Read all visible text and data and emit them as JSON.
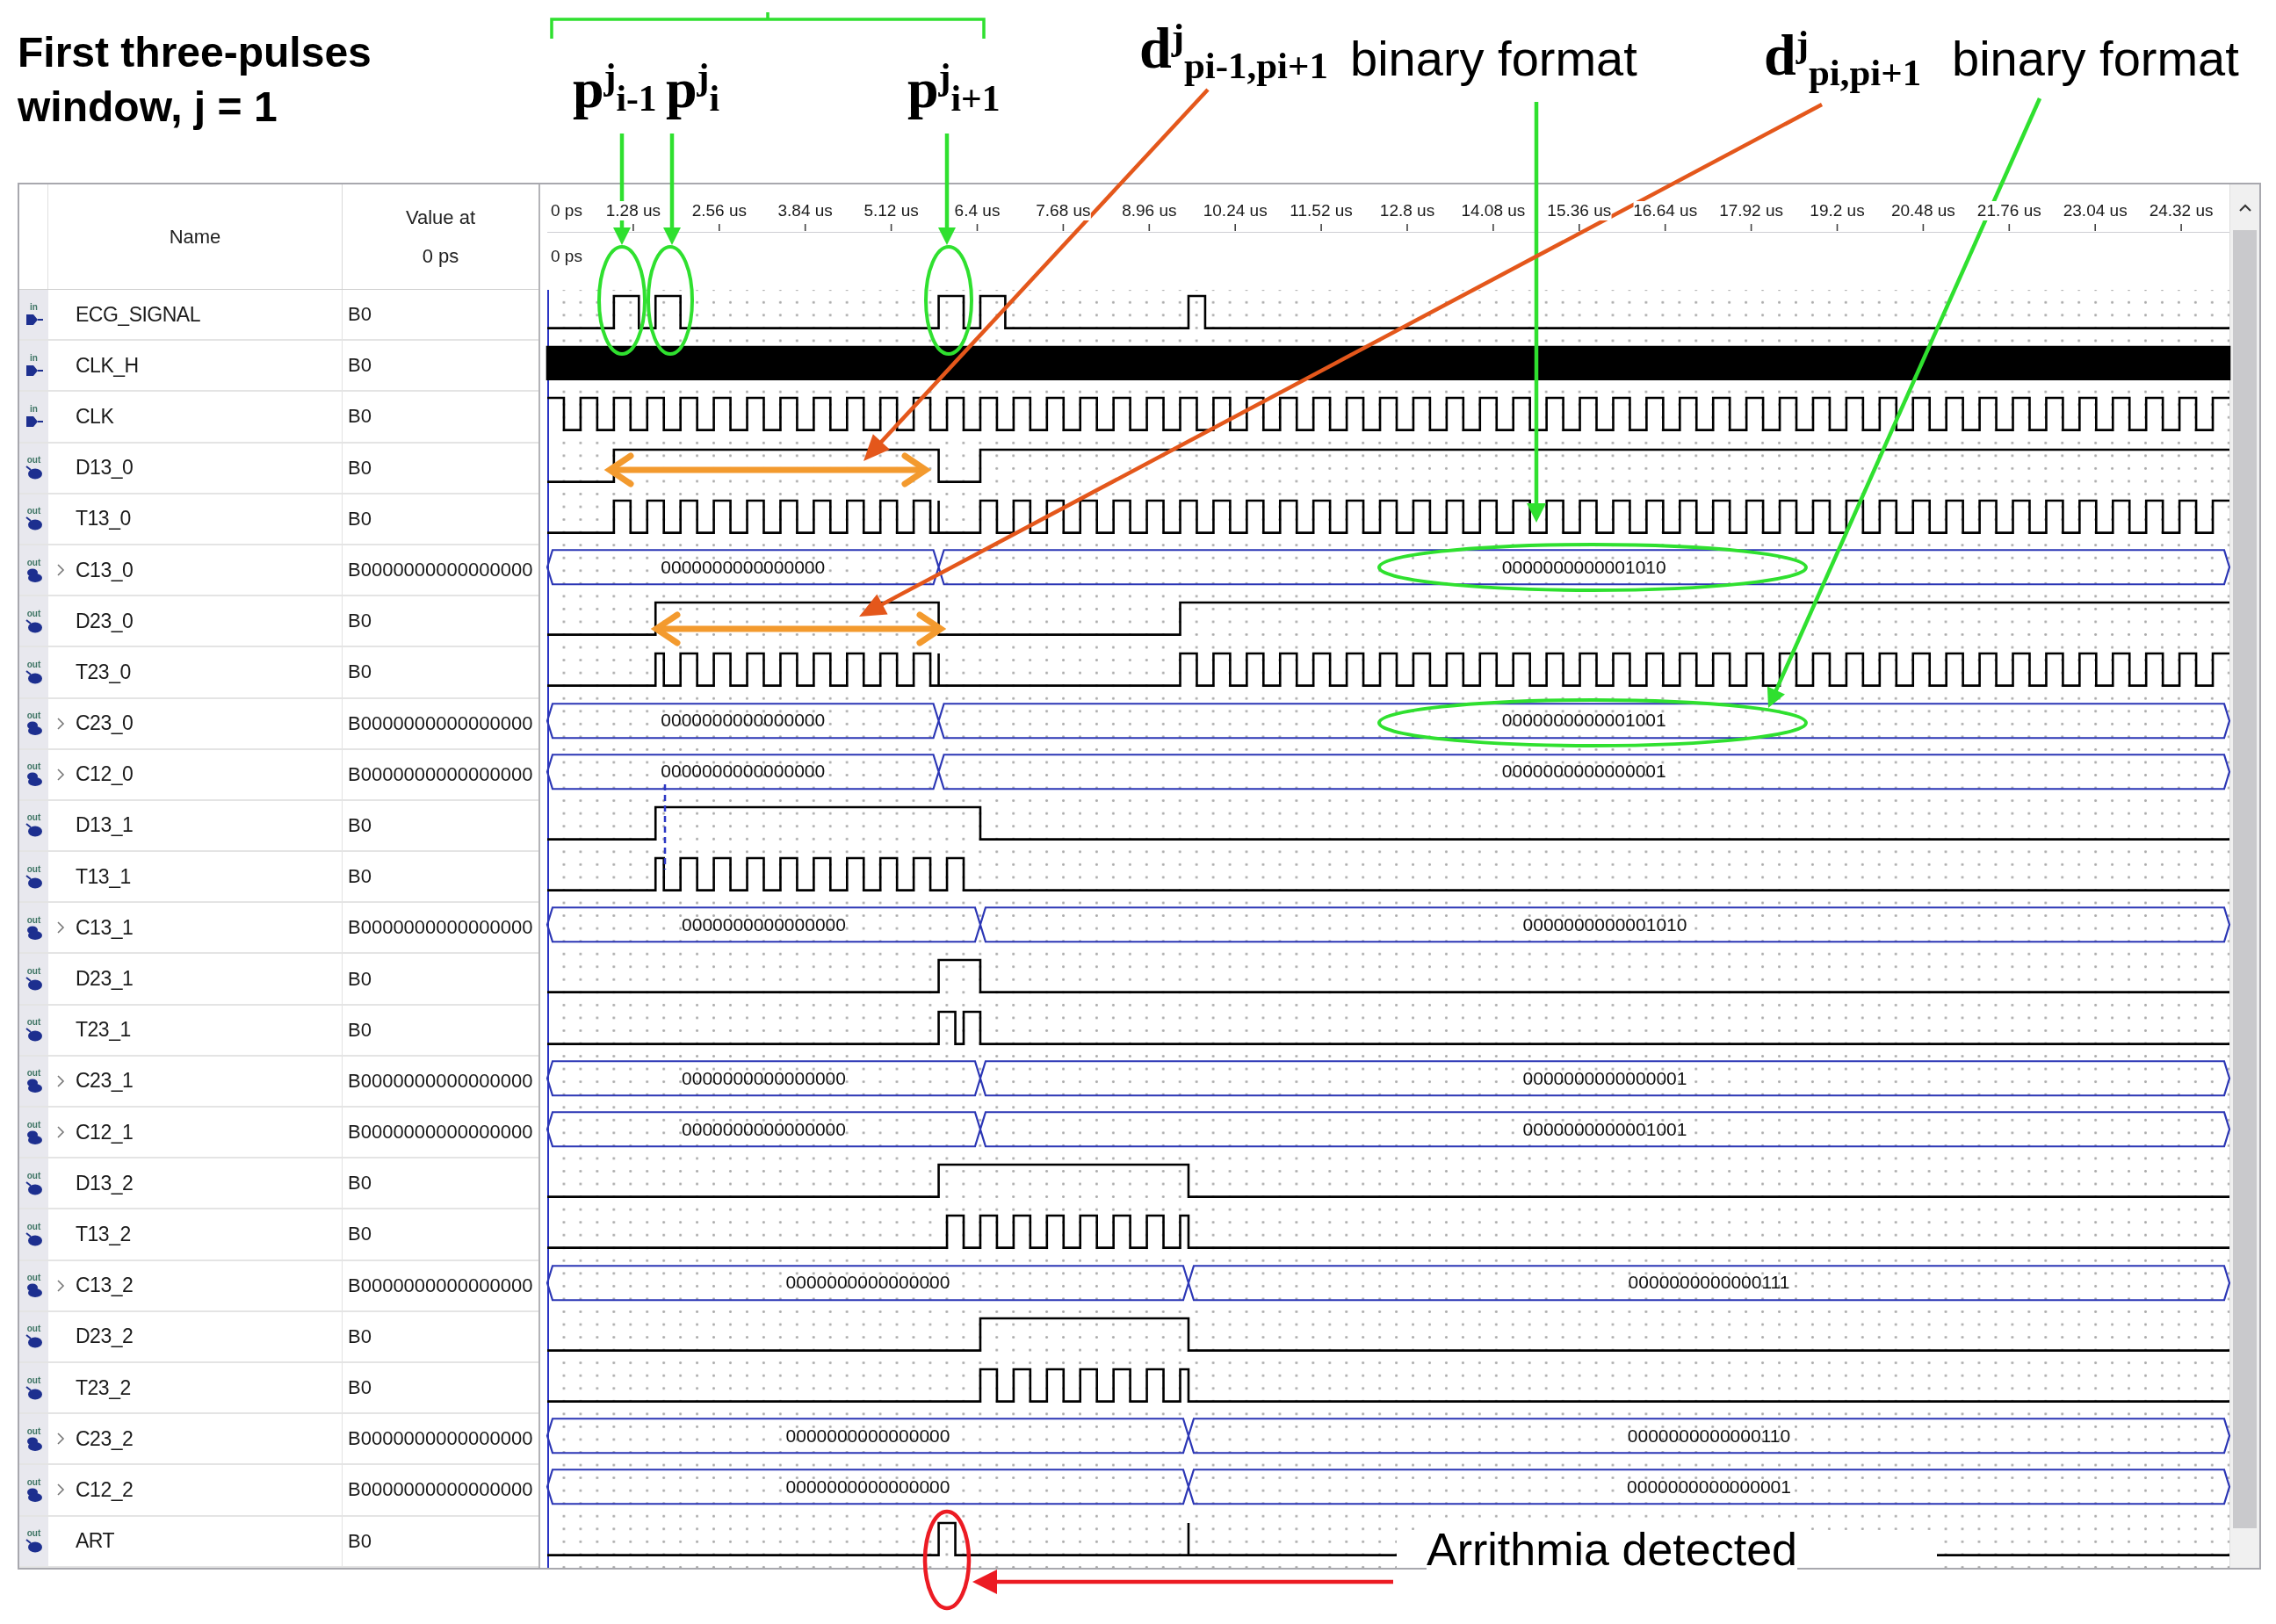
{
  "figure": {
    "title": "First three-pulses window, j = 1"
  },
  "annotations": [
    {
      "kind": "pulse",
      "text": "p$^{j}$$_{i-1}$"
    },
    {
      "kind": "pulse",
      "text": "p$^{j}$$_{i}$"
    },
    {
      "kind": "pulse",
      "text": "p$^{j}$$_{i+1}$"
    },
    {
      "kind": "interval",
      "text": "d$^{j}$$_{pi-1,pi+1}$"
    },
    {
      "kind": "note",
      "text": "binary format"
    },
    {
      "kind": "interval",
      "text": "d$^{j}$$_{pi,pi+1}$"
    },
    {
      "kind": "note",
      "text": "binary format"
    },
    {
      "kind": "alert",
      "text": "Arrithmia detected"
    }
  ],
  "waveform_viewer": {
    "columns": [
      "Name",
      "Value at 0 ps"
    ],
    "ruler": [
      "0 ps",
      "1.28 us",
      "2.56 us",
      "3.84 us",
      "5.12 us",
      "6.4 us",
      "7.68 us",
      "8.96 us",
      "10.24 us",
      "11.52 us",
      "12.8 us",
      "14.08 us",
      "15.36 us",
      "16.64 us",
      "17.92 us",
      "19.2 us",
      "20.48 us",
      "21.76 us",
      "23.04 us",
      "24.32 us"
    ],
    "cursor_time": "0 ps",
    "rows": [
      {
        "name": "ECG_SIGNAL",
        "port": "in",
        "kind": "bit",
        "value": "B0"
      },
      {
        "name": "CLK_H",
        "port": "in",
        "kind": "dense",
        "value": "B0"
      },
      {
        "name": "CLK",
        "port": "in",
        "kind": "bit",
        "value": "B0"
      },
      {
        "name": "D13_0",
        "port": "out",
        "kind": "bit",
        "value": "B0"
      },
      {
        "name": "T13_0",
        "port": "out",
        "kind": "bit",
        "value": "B0"
      },
      {
        "name": "C13_0",
        "port": "out",
        "kind": "bus",
        "expanded": false,
        "value": "B0000000000000000",
        "data": [
          "0000000000000000",
          "0000000000001010"
        ]
      },
      {
        "name": "D23_0",
        "port": "out",
        "kind": "bit",
        "value": "B0"
      },
      {
        "name": "T23_0",
        "port": "out",
        "kind": "bit",
        "value": "B0"
      },
      {
        "name": "C23_0",
        "port": "out",
        "kind": "bus",
        "expanded": false,
        "value": "B0000000000000000",
        "data": [
          "0000000000000000",
          "0000000000001001"
        ]
      },
      {
        "name": "C12_0",
        "port": "out",
        "kind": "bus",
        "expanded": false,
        "value": "B0000000000000000",
        "data": [
          "0000000000000000",
          "0000000000000001"
        ]
      },
      {
        "name": "D13_1",
        "port": "out",
        "kind": "bit",
        "value": "B0"
      },
      {
        "name": "T13_1",
        "port": "out",
        "kind": "bit",
        "value": "B0"
      },
      {
        "name": "C13_1",
        "port": "out",
        "kind": "bus",
        "expanded": false,
        "value": "B0000000000000000",
        "data": [
          "0000000000000000",
          "0000000000001010"
        ]
      },
      {
        "name": "D23_1",
        "port": "out",
        "kind": "bit",
        "value": "B0"
      },
      {
        "name": "T23_1",
        "port": "out",
        "kind": "bit",
        "value": "B0"
      },
      {
        "name": "C23_1",
        "port": "out",
        "kind": "bus",
        "expanded": false,
        "value": "B0000000000000000",
        "data": [
          "0000000000000000",
          "0000000000000001"
        ]
      },
      {
        "name": "C12_1",
        "port": "out",
        "kind": "bus",
        "expanded": false,
        "value": "B0000000000000000",
        "data": [
          "0000000000000000",
          "0000000000001001"
        ]
      },
      {
        "name": "D13_2",
        "port": "out",
        "kind": "bit",
        "value": "B0"
      },
      {
        "name": "T13_2",
        "port": "out",
        "kind": "bit",
        "value": "B0"
      },
      {
        "name": "C13_2",
        "port": "out",
        "kind": "bus",
        "expanded": false,
        "value": "B0000000000000000",
        "data": [
          "0000000000000000",
          "0000000000000111"
        ]
      },
      {
        "name": "D23_2",
        "port": "out",
        "kind": "bit",
        "value": "B0"
      },
      {
        "name": "T23_2",
        "port": "out",
        "kind": "bit",
        "value": "B0"
      },
      {
        "name": "C23_2",
        "port": "out",
        "kind": "bus",
        "expanded": false,
        "value": "B0000000000000000",
        "data": [
          "0000000000000000",
          "0000000000000110"
        ]
      },
      {
        "name": "C12_2",
        "port": "out",
        "kind": "bus",
        "expanded": false,
        "value": "B0000000000000000",
        "data": [
          "0000000000000000",
          "0000000000000001"
        ]
      },
      {
        "name": "ART",
        "port": "out",
        "kind": "bit",
        "value": "B0"
      }
    ]
  }
}
